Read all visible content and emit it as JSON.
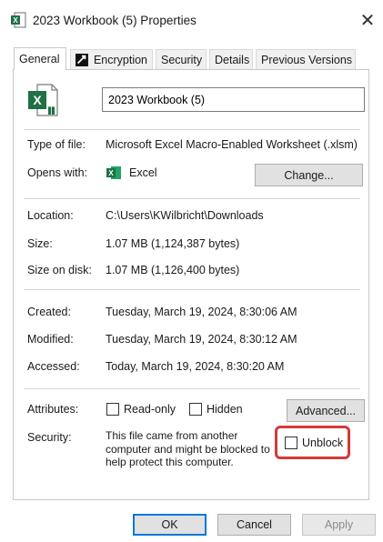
{
  "window": {
    "title": "2023 Workbook (5) Properties",
    "close_glyph": "✕",
    "title_icon": "excel-file-icon"
  },
  "tabs": [
    {
      "label": "General",
      "active": true
    },
    {
      "label": "Encryption",
      "icon": "encryption-icon"
    },
    {
      "label": "Security"
    },
    {
      "label": "Details"
    },
    {
      "label": "Previous Versions"
    }
  ],
  "general": {
    "file_name": "2023 Workbook (5)",
    "type_label": "Type of file:",
    "type_value": "Microsoft Excel Macro-Enabled Worksheet (.xlsm)",
    "opens_label": "Opens with:",
    "opens_value": "Excel",
    "change_button": "Change...",
    "location_label": "Location:",
    "location_value": "C:\\Users\\KWilbricht\\Downloads",
    "size_label": "Size:",
    "size_value": "1.07 MB (1,124,387 bytes)",
    "size_on_disk_label": "Size on disk:",
    "size_on_disk_value": "1.07 MB (1,126,400 bytes)",
    "created_label": "Created:",
    "created_value": "Tuesday, March 19, 2024, 8:30:06 AM",
    "modified_label": "Modified:",
    "modified_value": "Tuesday, March 19, 2024, 8:30:12 AM",
    "accessed_label": "Accessed:",
    "accessed_value": "Today, March 19, 2024, 8:30:20 AM",
    "attributes_label": "Attributes:",
    "readonly_label": "Read-only",
    "readonly_checked": false,
    "hidden_label": "Hidden",
    "hidden_checked": false,
    "advanced_button": "Advanced...",
    "security_label": "Security:",
    "security_text": "This file came from another computer and might be blocked to help protect this computer.",
    "unblock_label": "Unblock",
    "unblock_checked": false
  },
  "footer": {
    "ok": "OK",
    "cancel": "Cancel",
    "apply": "Apply",
    "apply_disabled": true
  },
  "colors": {
    "excel_green": "#1e7145",
    "highlight_red": "#d33a3a",
    "focus_blue": "#0078d7"
  }
}
